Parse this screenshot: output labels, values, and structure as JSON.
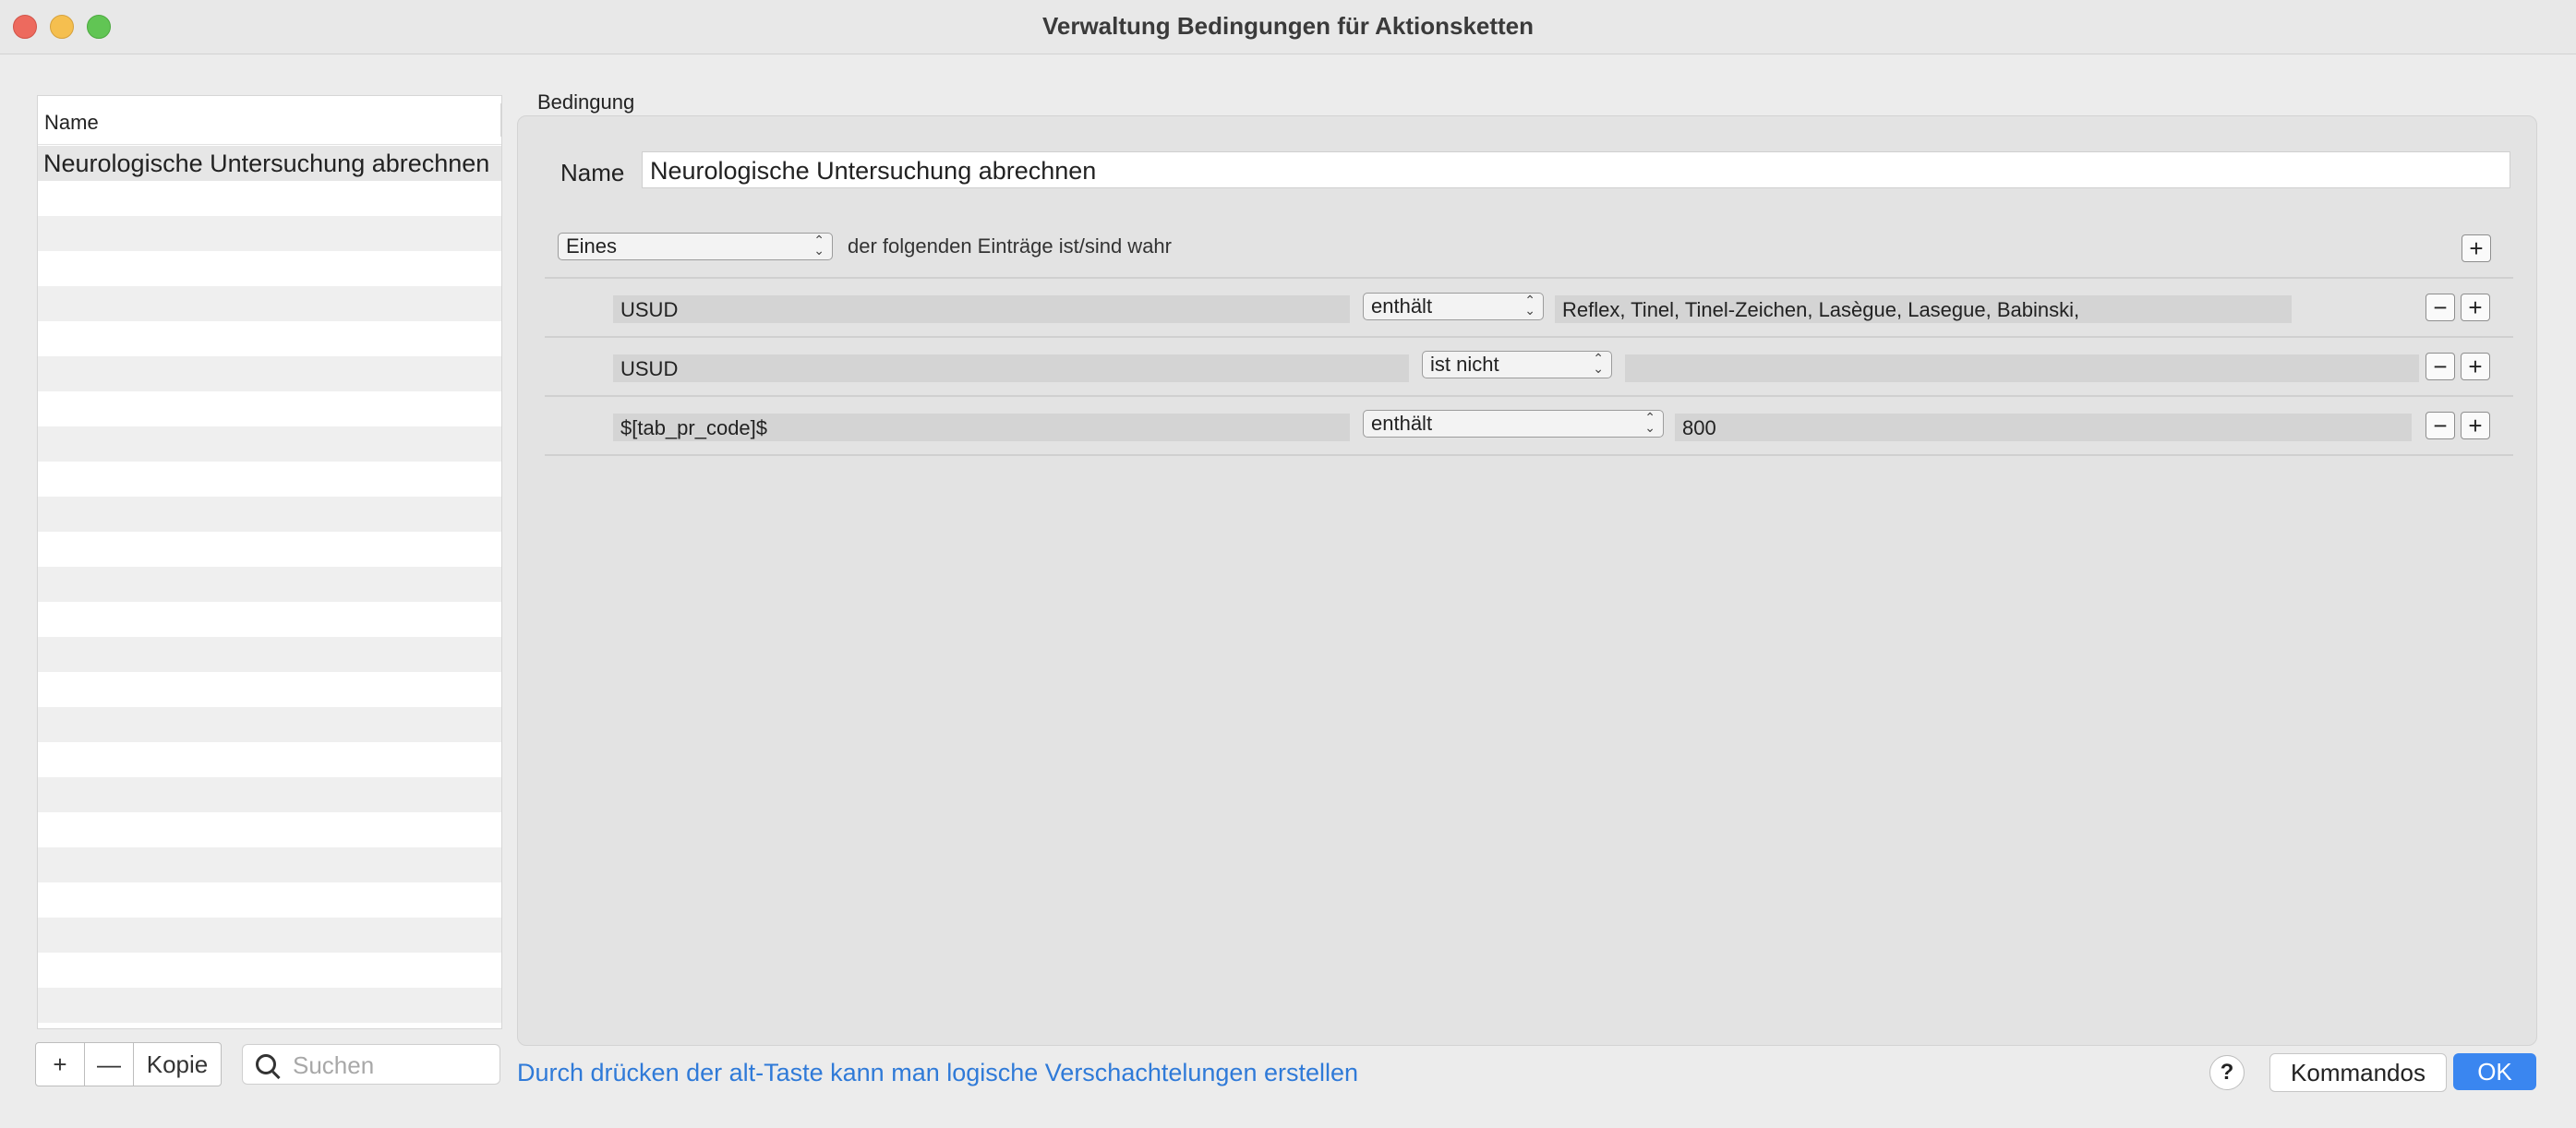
{
  "window": {
    "title": "Verwaltung Bedingungen für Aktionsketten"
  },
  "list": {
    "header": "Name",
    "items": [
      "Neurologische Untersuchung abrechnen"
    ]
  },
  "list_buttons": {
    "add": "+",
    "remove": "—",
    "copy": "Kopie"
  },
  "search": {
    "placeholder": "Suchen"
  },
  "condition": {
    "group_label": "Bedingung",
    "name_label": "Name",
    "name_value": "Neurologische Untersuchung abrechnen",
    "mode": "Eines",
    "mode_description": "der folgenden Einträge ist/sind wahr",
    "rules": [
      {
        "field": "USUD",
        "operator": "enthält",
        "value": "Reflex, Tinel, Tinel-Zeichen, Lasègue, Lasegue, Babinski,"
      },
      {
        "field": "USUD",
        "operator": "ist nicht",
        "value": ""
      },
      {
        "field": "$[tab_pr_code]$",
        "operator": "enthält",
        "value": "800"
      }
    ]
  },
  "footer": {
    "hint": "Durch drücken der alt-Taste kann man logische Verschachtelungen erstellen",
    "help": "?",
    "commands": "Kommandos",
    "ok": "OK"
  }
}
